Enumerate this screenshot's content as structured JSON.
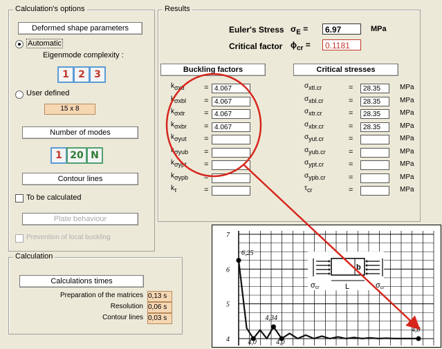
{
  "options": {
    "group_label": "Calculation's options",
    "deformed_shape": "Deformed shape parameters",
    "automatic_label": "Automatic",
    "eigenmode_label": "Eigenmode complexity :",
    "complexity_buttons": [
      "1",
      "2",
      "3"
    ],
    "user_defined_label": "User defined",
    "user_defined_value": "15 x 8",
    "number_of_modes": "Number of modes",
    "mode_buttons": [
      "1",
      "20",
      "N"
    ],
    "contour_lines": "Contour lines",
    "to_be_calculated": "To be calculated",
    "plate_behaviour": "Plate behaviour",
    "prevention_local_buckling": "Prevention of local buckling"
  },
  "results": {
    "group_label": "Results",
    "euler_label": "Euler's Stress",
    "euler_symbol": "σ",
    "euler_sub": "E",
    "euler_value": "6.97",
    "euler_unit": "MPa",
    "critical_label": "Critical factor",
    "critical_symbol": "ϕ",
    "critical_sub": "cr",
    "critical_value": "0.1181",
    "buckling_header": "Buckling factors",
    "stresses_header": "Critical stresses",
    "k_rows": [
      {
        "sub": "σxtl",
        "value": "4.067"
      },
      {
        "sub": "σxbl",
        "value": "4.067"
      },
      {
        "sub": "σxtr",
        "value": "4.067"
      },
      {
        "sub": "σxbr",
        "value": "4.067"
      },
      {
        "sub": "σyut",
        "value": ""
      },
      {
        "sub": "σyub",
        "value": ""
      },
      {
        "sub": "σypt",
        "value": ""
      },
      {
        "sub": "σypb",
        "value": ""
      },
      {
        "sub": "τ",
        "value": ""
      }
    ],
    "s_rows": [
      {
        "sub": "xtl.cr",
        "value": "28.35"
      },
      {
        "sub": "xbl.cr",
        "value": "28.35"
      },
      {
        "sub": "xtr.cr",
        "value": "28.35"
      },
      {
        "sub": "xbr.cr",
        "value": "28.35"
      },
      {
        "sub": "yut.cr",
        "value": ""
      },
      {
        "sub": "yub.cr",
        "value": ""
      },
      {
        "sub": "ypt.cr",
        "value": ""
      },
      {
        "sub": "ypb.cr",
        "value": ""
      },
      {
        "sub": "cr",
        "value": ""
      }
    ],
    "k_symbol": "k",
    "sigma_symbol": "σ",
    "tau_symbol": "τ",
    "unit": "MPa"
  },
  "calculation": {
    "group_label": "Calculation",
    "times_header": "Calculations times",
    "rows": [
      {
        "label": "Preparation of the matrices",
        "value": "0,13 s"
      },
      {
        "label": "Resolution",
        "value": "0,06 s"
      },
      {
        "label": "Contour lines",
        "value": "0,03 s"
      }
    ]
  },
  "chart_data": {
    "type": "line",
    "y_ticks": [
      "4",
      "5",
      "6",
      "7"
    ],
    "ylim": [
      3.8,
      7.1
    ],
    "annotations": [
      "6,25",
      "4,34",
      "4,0",
      "4,0",
      "4,0"
    ],
    "inset_labels": {
      "b": "b",
      "L": "L",
      "sigma_left": "σ",
      "sigma_left_sub": "cr",
      "sigma_right": "σ",
      "sigma_right_sub": "cr"
    },
    "points": [
      [
        0,
        6.25
      ],
      [
        0.3,
        4.3
      ],
      [
        0.55,
        4.0
      ],
      [
        0.8,
        4.25
      ],
      [
        1.05,
        4.0
      ],
      [
        1.3,
        4.34
      ],
      [
        1.6,
        4.0
      ],
      [
        1.9,
        4.15
      ],
      [
        2.2,
        4.0
      ],
      [
        2.5,
        4.1
      ],
      [
        2.8,
        4.0
      ],
      [
        3.1,
        4.07
      ],
      [
        3.4,
        4.0
      ],
      [
        3.7,
        4.05
      ],
      [
        4.0,
        4.0
      ],
      [
        4.3,
        4.03
      ],
      [
        4.6,
        4.0
      ],
      [
        4.9,
        4.02
      ],
      [
        5.2,
        4.0
      ],
      [
        5.5,
        4.01
      ],
      [
        5.8,
        4.0
      ],
      [
        6.1,
        4.0
      ],
      [
        6.4,
        4.0
      ],
      [
        6.7,
        4.0
      ]
    ],
    "x_max": 6.7,
    "colors": {
      "curve": "#111111",
      "highlight": "#d6261c"
    }
  }
}
